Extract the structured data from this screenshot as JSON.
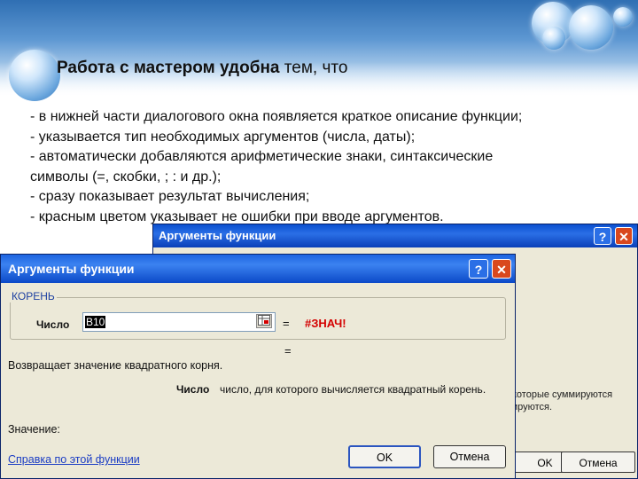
{
  "slide": {
    "title_bold": "Работа с мастером удобна",
    "title_rest": "тем, что",
    "bullets": [
      "- в нижней части диалогового окна появляется краткое описание функции;",
      "- указывается тип необходимых аргументов (числа, даты);",
      "- автоматически добавляются арифметические знаки, синтаксические",
      "символы (=, скобки, ; : и др.);",
      "- сразу показывает результат вычисления;",
      "- красным цветом указывает не ошибки при вводе аргументов."
    ]
  },
  "back_dialog": {
    "title": "Аргументы функции",
    "help_label": "?",
    "close_label": "✕",
    "partial_text_1": "которые суммируются",
    "partial_text_2": "ируются.",
    "ok_label": "OK",
    "cancel_label": "Отмена"
  },
  "dialog": {
    "title": "Аргументы функции",
    "help_label": "?",
    "close_label": "✕",
    "group_label": "КОРЕНЬ",
    "field_label": "Число",
    "field_value": "B10",
    "ref_icon": "range-select-icon",
    "equals": "=",
    "result": "#ЗНАЧ!",
    "equals2": "=",
    "description": "Возвращает значение квадратного корня.",
    "arg_name": "Число",
    "arg_description": "число, для которого вычисляется квадратный корень.",
    "value_label": "Значение:",
    "help_link": "Справка по этой функции",
    "ok_label": "OK",
    "cancel_label": "Отмена"
  },
  "colors": {
    "title_bar": "#1d64e0",
    "error_red": "#d40000",
    "dialog_bg": "#ece9d8",
    "link_blue": "#1a3cc4"
  }
}
